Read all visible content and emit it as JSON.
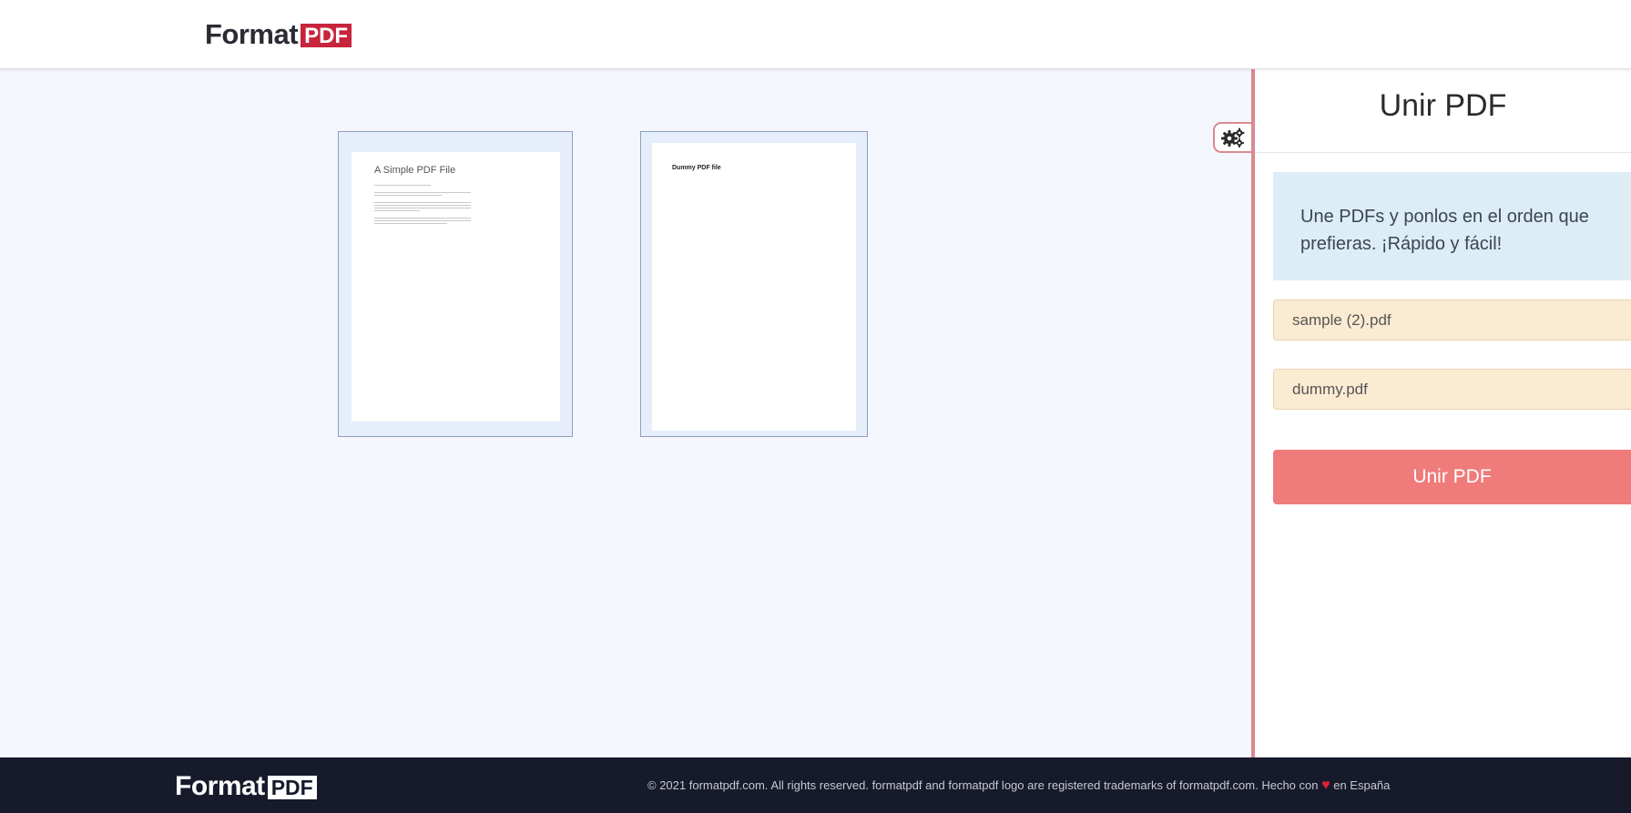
{
  "header": {
    "logo_word": "Format",
    "logo_badge": "PDF"
  },
  "workspace": {
    "thumbnails": [
      {
        "title": "A Simple PDF File"
      },
      {
        "title": "Dummy PDF file"
      }
    ]
  },
  "panel": {
    "title": "Unir PDF",
    "description": "Une PDFs y ponlos en el orden que prefieras. ¡Rápido y fácil!",
    "files": [
      "sample (2).pdf",
      "dummy.pdf"
    ],
    "merge_button_label": "Unir PDF"
  },
  "footer": {
    "logo_word": "Format",
    "logo_badge": "PDF",
    "copyright_prefix": "© 2021 formatpdf.com. All rights reserved. formatpdf and formatpdf logo are registered trademarks of formatpdf.com. Hecho con",
    "heart": "♥",
    "copyright_suffix": "en España"
  },
  "colors": {
    "accent": "#c8243c",
    "button": "#ef7b7b",
    "divider": "#d98a8f",
    "info_bg": "#ddedf6",
    "file_bg": "#fcebd3",
    "footer_bg": "#161a2b"
  },
  "icons": {
    "settings": "gears-icon"
  }
}
